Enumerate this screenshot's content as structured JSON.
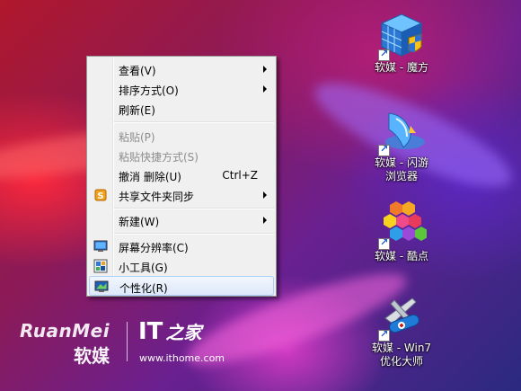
{
  "context_menu": {
    "items": [
      {
        "label": "查看(V)",
        "has_submenu": true
      },
      {
        "label": "排序方式(O)",
        "has_submenu": true
      },
      {
        "label": "刷新(E)"
      },
      {
        "label": "粘贴(P)",
        "disabled": true
      },
      {
        "label": "粘贴快捷方式(S)",
        "disabled": true
      },
      {
        "label": "撤消 删除(U)",
        "shortcut": "Ctrl+Z"
      },
      {
        "label": "共享文件夹同步",
        "has_submenu": true,
        "icon": "sync-folder-icon"
      },
      {
        "label": "新建(W)",
        "has_submenu": true
      },
      {
        "label": "屏幕分辨率(C)",
        "icon": "display-icon"
      },
      {
        "label": "小工具(G)",
        "icon": "gadgets-icon"
      },
      {
        "label": "个性化(R)",
        "icon": "personalize-icon",
        "highlighted": true
      }
    ]
  },
  "desktop_icons": [
    {
      "line1": "软媒 - 魔方",
      "line2": "",
      "icon": "rubiks-cube-icon"
    },
    {
      "line1": "软媒 - 闪游",
      "line2": "浏览器",
      "icon": "browser-icon"
    },
    {
      "line1": "软媒 - 酷点",
      "line2": "",
      "icon": "hexagon-cluster-icon"
    },
    {
      "line1": "软媒 - Win7",
      "line2": "优化大师",
      "icon": "swiss-knife-icon"
    }
  ],
  "watermark": {
    "brand_latin": "RuanMei",
    "brand_cn": "软媒",
    "it_logo": "IT",
    "it_logo_cn": "之家",
    "site_url": "www.ithome.com"
  },
  "colors": {
    "menu_bg": "#f0f0f0",
    "highlight_border": "#aecff7",
    "disabled_text": "#8d8d8d"
  }
}
